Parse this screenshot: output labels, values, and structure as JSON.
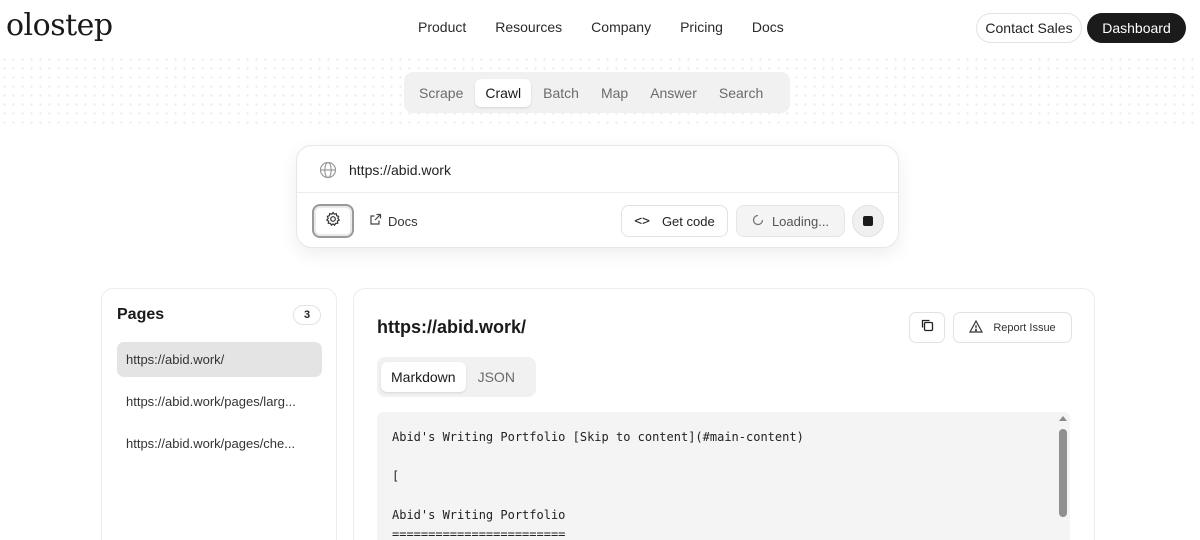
{
  "nav": {
    "logo": "olostep",
    "links": [
      "Product",
      "Resources",
      "Company",
      "Pricing",
      "Docs"
    ],
    "contact_label": "Contact Sales",
    "dashboard_label": "Dashboard"
  },
  "mode_tabs": {
    "items": [
      "Scrape",
      "Crawl",
      "Batch",
      "Map",
      "Answer",
      "Search"
    ],
    "active": "Crawl"
  },
  "url_card": {
    "url_value": "https://abid.work",
    "docs_label": "Docs",
    "get_code_label": "Get code",
    "loading_label": "Loading..."
  },
  "pages": {
    "title": "Pages",
    "count": "3",
    "items": [
      "https://abid.work/",
      "https://abid.work/pages/larg...",
      "https://abid.work/pages/che..."
    ]
  },
  "content": {
    "url_title": "https://abid.work/",
    "report_label": "Report Issue",
    "format_tabs": [
      "Markdown",
      "JSON"
    ],
    "active_format": "Markdown",
    "markdown_lines": [
      "Abid's Writing Portfolio [Skip to content](#main-content)",
      "",
      "[",
      "",
      "Abid's Writing Portfolio",
      "========================"
    ]
  },
  "colors": {
    "dashboard_bg": "#1b1b1b",
    "active_page_bg": "#e4e4e4",
    "code_bg": "#f4f4f4"
  }
}
